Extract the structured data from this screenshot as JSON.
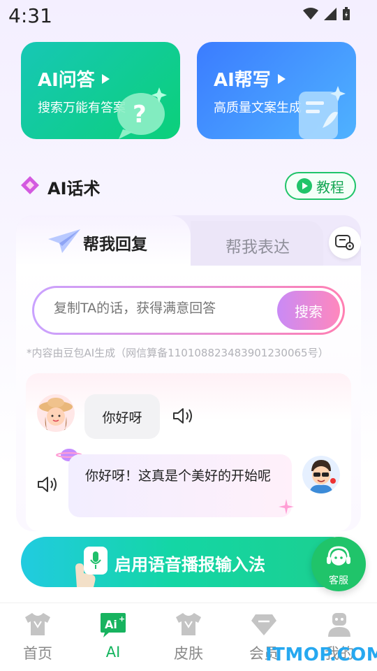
{
  "status_bar": {
    "time": "4:31"
  },
  "cards": {
    "qa": {
      "title": "AI问答",
      "subtitle": "搜索万能有答案"
    },
    "write": {
      "title": "AI帮写",
      "subtitle": "高质量文案生成"
    }
  },
  "section": {
    "title": "AI话术",
    "tutorial_label": "教程"
  },
  "tabs": [
    {
      "label": "帮我回复",
      "active": true
    },
    {
      "label": "帮我表达",
      "active": false
    }
  ],
  "search": {
    "placeholder": "复制TA的话，获得满意回答",
    "button_label": "搜索"
  },
  "disclaimer": "*内容由豆包AI生成（网信算备110108823483901230065号）",
  "chat": [
    {
      "side": "left",
      "text": "你好呀"
    },
    {
      "side": "right",
      "text": "你好呀！这真是个美好的开始呢"
    }
  ],
  "voice_banner": {
    "label": "启用语音播报输入法"
  },
  "customer_service": {
    "label": "客服"
  },
  "bottom_nav": [
    {
      "label": "首页",
      "icon": "shirt-icon",
      "active": false
    },
    {
      "label": "AI",
      "icon": "ai-icon",
      "active": true
    },
    {
      "label": "皮肤",
      "icon": "shirt-icon",
      "active": false
    },
    {
      "label": "会员",
      "icon": "diamond-icon",
      "active": false
    },
    {
      "label": "我的",
      "icon": "user-icon",
      "active": false
    }
  ],
  "watermark": "ITMOP.COM",
  "colors": {
    "accent_green": "#20c46a",
    "qa_card": "#0bd07a",
    "write_card": "#3b7cff",
    "search_button": "#e58ad8"
  }
}
